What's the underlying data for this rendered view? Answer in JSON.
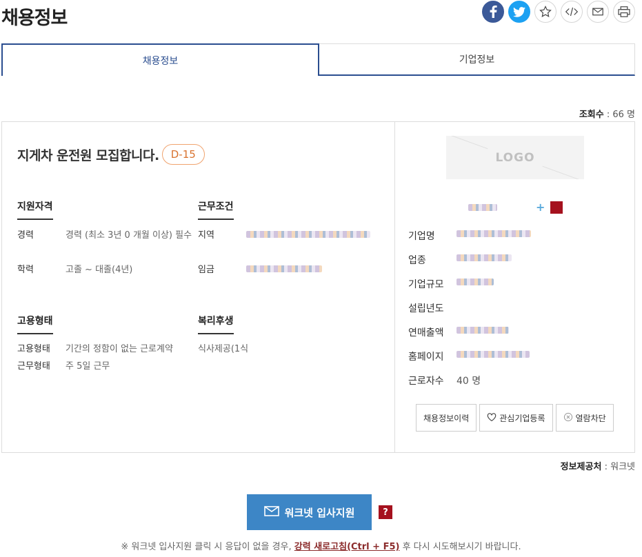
{
  "page_title": "채용정보",
  "share": [
    "facebook-icon",
    "twitter-icon",
    "star-icon",
    "code-icon",
    "mail-icon",
    "print-icon"
  ],
  "tabs": [
    {
      "label": "채용정보",
      "active": true
    },
    {
      "label": "기업정보",
      "active": false
    }
  ],
  "view_count": {
    "label": "조회수",
    "value": "66 명"
  },
  "job": {
    "title": "지게차 운전원 모집합니다.",
    "dday": "D-15"
  },
  "qualification": {
    "title": "지원자격",
    "rows": [
      {
        "label": "경력",
        "value": "경력 (최소 3년 0 개월 이상) 필수"
      },
      {
        "label": "학력",
        "value": "고졸 ~ 대졸(4년)"
      }
    ]
  },
  "conditions": {
    "title": "근무조건",
    "rows": [
      {
        "label": "지역",
        "value": ""
      },
      {
        "label": "임금",
        "value": ""
      }
    ]
  },
  "employment": {
    "title": "고용형태",
    "rows": [
      {
        "label": "고용형태",
        "value": "기간의 정함이 없는 근로계약"
      },
      {
        "label": "근무형태",
        "value": "주 5일 근무"
      }
    ]
  },
  "welfare": {
    "title": "복리후생",
    "value": "식사제공(1식"
  },
  "company": {
    "logo_text": "LOGO",
    "rows": [
      {
        "label": "기업명",
        "value": ""
      },
      {
        "label": "업종",
        "value": ""
      },
      {
        "label": "기업규모",
        "value": ""
      },
      {
        "label": "설립년도",
        "value": ""
      },
      {
        "label": "연매출액",
        "value": ""
      },
      {
        "label": "홈페이지",
        "value": ""
      },
      {
        "label": "근로자수",
        "value": "40 명"
      }
    ],
    "buttons": {
      "history": "채용정보이력",
      "favorite": "관심기업등록",
      "block": "열람차단"
    }
  },
  "source": {
    "label": "정보제공처",
    "value": "워크넷"
  },
  "apply": {
    "label": "워크넷 입사지원",
    "help": "?"
  },
  "notice": {
    "prefix": "※ 워크넷 입사지원 클릭 시 응답이 없을 경우, ",
    "link": "강력 새로고침(Ctrl + F5)",
    "suffix": " 후 다시 시도해보시기 바랍니다."
  }
}
